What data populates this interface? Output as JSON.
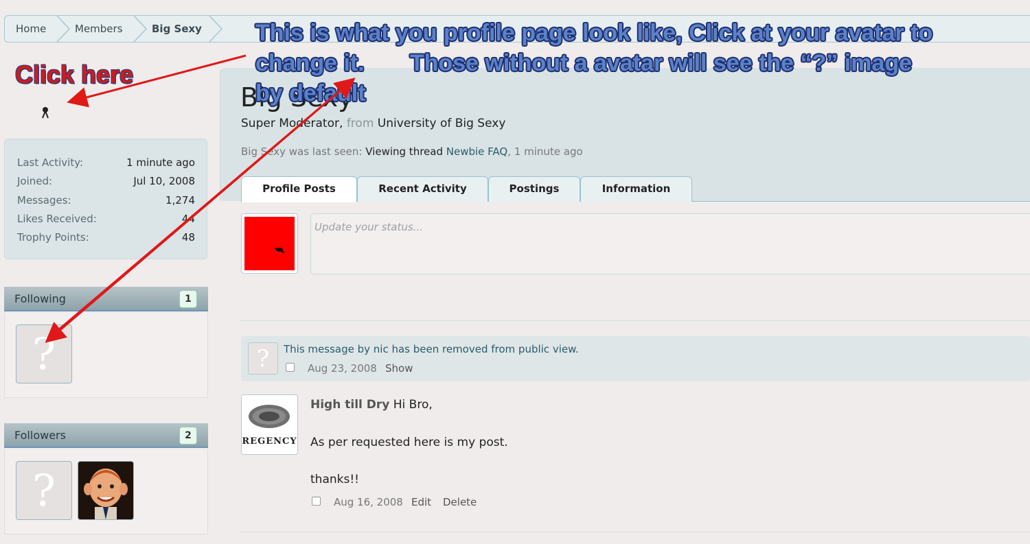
{
  "breadcrumb": [
    "Home",
    "Members",
    "Big Sexy"
  ],
  "annotation": {
    "line1": "This is what you profile page look like, Click at your avatar to",
    "line2": "change it.       Those without a avatar will see the “?” image",
    "line3": "by default",
    "click_here": "Click here"
  },
  "sidebar": {
    "stats": [
      {
        "label": "Last Activity:",
        "value": "1 minute ago"
      },
      {
        "label": "Joined:",
        "value": "Jul 10, 2008"
      },
      {
        "label": "Messages:",
        "value": "1,274"
      },
      {
        "label": "Likes Received:",
        "value": "44"
      },
      {
        "label": "Trophy Points:",
        "value": "48"
      }
    ],
    "following": {
      "title": "Following",
      "count": "1"
    },
    "followers": {
      "title": "Followers",
      "count": "2"
    }
  },
  "profile": {
    "name": "Big Sexy",
    "title": "Super Moderator,",
    "from_word": "from",
    "location": "University of Big Sexy",
    "last_seen_prefix": "Big Sexy was last seen:",
    "last_seen_action": "Viewing thread",
    "last_seen_thread": "Newbie FAQ",
    "last_seen_time": ", 1 minute ago"
  },
  "tabs": [
    "Profile Posts",
    "Recent Activity",
    "Postings",
    "Information"
  ],
  "status": {
    "placeholder": "Update your status..."
  },
  "removed_message": {
    "text": "This message by nic has been removed from public view.",
    "date": "Aug 23, 2008",
    "show": "Show"
  },
  "post": {
    "author": "High till Dry",
    "line1": "Hi Bro,",
    "line2": "As per requested here is my post.",
    "line3": "thanks!!",
    "date": "Aug 16, 2008",
    "edit": "Edit",
    "delete": "Delete",
    "avatar_text": "REGENCY"
  },
  "colors": {
    "annotation_text": "#5b82c9",
    "arrow": "#e01818",
    "avatar_bg": "#ff0000"
  }
}
